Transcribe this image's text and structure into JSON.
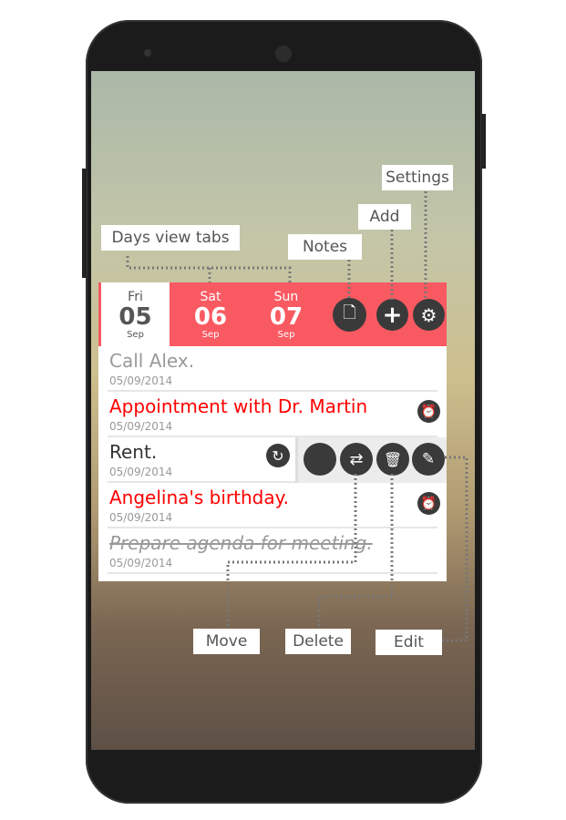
{
  "tabs": [
    {
      "day": "Fri",
      "num": "05",
      "month": "Sep",
      "active": true
    },
    {
      "day": "Sat",
      "num": "06",
      "month": "Sep"
    },
    {
      "day": "Sun",
      "num": "07",
      "month": "Sep"
    }
  ],
  "header_icons": [
    "notes-icon",
    "add-icon",
    "settings-icon"
  ],
  "tasks": [
    {
      "title": "Call Alex.",
      "date": "05/09/2014",
      "style": "gray"
    },
    {
      "title": "Appointment with Dr. Martin",
      "date": "05/09/2014",
      "style": "red",
      "icon": "alarm-icon"
    },
    {
      "title": "Rent.",
      "date": "05/09/2014",
      "style": "dark",
      "icon": "repeat-icon"
    },
    {
      "title": "Angelina's birthday.",
      "date": "05/09/2014",
      "style": "red",
      "icon": "alarm-icon"
    },
    {
      "title": "Prepare agenda for meeting.",
      "date": "05/09/2014",
      "style": "done"
    }
  ],
  "row_actions": [
    "blank",
    "move-icon",
    "delete-icon",
    "edit-icon"
  ],
  "callouts": {
    "days": "Days view tabs",
    "notes": "Notes",
    "add": "Add",
    "settings": "Settings",
    "move": "Move",
    "delete": "Delete",
    "edit": "Edit"
  },
  "colors": {
    "accent": "#f95a62",
    "red_text": "#ff0000"
  }
}
